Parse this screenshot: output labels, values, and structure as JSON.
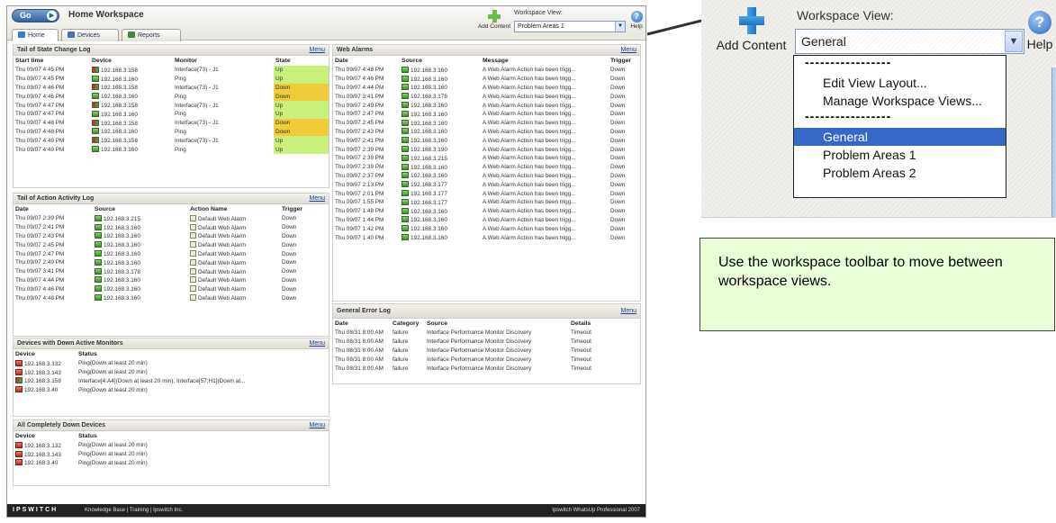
{
  "app": {
    "go_label": "Go",
    "title": "Home Workspace",
    "tabs": [
      {
        "label": "Home",
        "icon": "home-icon",
        "color": "#3b7ad3"
      },
      {
        "label": "Devices",
        "icon": "devices-icon",
        "color": "#4f6fb0"
      },
      {
        "label": "Reports",
        "icon": "reports-icon",
        "color": "#3f8a3a"
      }
    ],
    "add_content_label": "Add Content",
    "workspace_view_label": "Workspace View:",
    "workspace_view_selected": "Problem Areas 1",
    "help_label": "Help"
  },
  "state_change": {
    "title": "Tail of State Change Log",
    "menu": "Menu",
    "columns": [
      "Start time",
      "Device",
      "Monitor",
      "State"
    ],
    "rows": [
      {
        "time": "Thu 09/07 4:45 PM",
        "device": "192.168.3.158",
        "icon": "mix",
        "monitor": "Interface(73) - J1",
        "state": "Up"
      },
      {
        "time": "Thu 09/07 4:45 PM",
        "device": "192.168.3.160",
        "icon": "green",
        "monitor": "Ping",
        "state": "Up"
      },
      {
        "time": "Thu 09/07 4:46 PM",
        "device": "192.168.3.158",
        "icon": "mix",
        "monitor": "Interface(73) - J1",
        "state": "Down"
      },
      {
        "time": "Thu 09/07 4:46 PM",
        "device": "192.168.3.160",
        "icon": "green",
        "monitor": "Ping",
        "state": "Down"
      },
      {
        "time": "Thu 09/07 4:47 PM",
        "device": "192.168.3.158",
        "icon": "mix",
        "monitor": "Interface(73) - J1",
        "state": "Up"
      },
      {
        "time": "Thu 09/07 4:47 PM",
        "device": "192.168.3.160",
        "icon": "green",
        "monitor": "Ping",
        "state": "Up"
      },
      {
        "time": "Thu 09/07 4:48 PM",
        "device": "192.168.3.158",
        "icon": "mix",
        "monitor": "Interface(73) - J1",
        "state": "Down"
      },
      {
        "time": "Thu 09/07 4:48 PM",
        "device": "192.168.3.160",
        "icon": "green",
        "monitor": "Ping",
        "state": "Down"
      },
      {
        "time": "Thu 09/07 4:49 PM",
        "device": "192.168.3.158",
        "icon": "mix",
        "monitor": "Interface(73) - J1",
        "state": "Up"
      },
      {
        "time": "Thu 09/07 4:49 PM",
        "device": "192.168.3.160",
        "icon": "green",
        "monitor": "Ping",
        "state": "Up"
      }
    ]
  },
  "action_activity": {
    "title": "Tail of Action Activity Log",
    "menu": "Menu",
    "columns": [
      "Date",
      "Source",
      "Action Name",
      "Trigger"
    ],
    "rows": [
      {
        "date": "Thu 09/07 2:39 PM",
        "source": "192.168.3.215",
        "action": "Default Web Alarm",
        "trigger": "Down"
      },
      {
        "date": "Thu 09/07 2:41 PM",
        "source": "192.168.3.160",
        "action": "Default Web Alarm",
        "trigger": "Down"
      },
      {
        "date": "Thu 09/07 2:43 PM",
        "source": "192.168.3.160",
        "action": "Default Web Alarm",
        "trigger": "Down"
      },
      {
        "date": "Thu 09/07 2:45 PM",
        "source": "192.168.3.160",
        "action": "Default Web Alarm",
        "trigger": "Down"
      },
      {
        "date": "Thu 09/07 2:47 PM",
        "source": "192.168.3.160",
        "action": "Default Web Alarm",
        "trigger": "Down"
      },
      {
        "date": "Thu 09/07 2:49 PM",
        "source": "192.168.3.160",
        "action": "Default Web Alarm",
        "trigger": "Down"
      },
      {
        "date": "Thu 09/07 3:41 PM",
        "source": "192.168.3.178",
        "action": "Default Web Alarm",
        "trigger": "Down"
      },
      {
        "date": "Thu 09/07 4:44 PM",
        "source": "192.168.3.160",
        "action": "Default Web Alarm",
        "trigger": "Down"
      },
      {
        "date": "Thu 09/07 4:46 PM",
        "source": "192.168.3.160",
        "action": "Default Web Alarm",
        "trigger": "Down"
      },
      {
        "date": "Thu 09/07 4:48 PM",
        "source": "192.168.3.160",
        "action": "Default Web Alarm",
        "trigger": "Down"
      }
    ]
  },
  "down_monitors": {
    "title": "Devices with Down Active Monitors",
    "menu": "Menu",
    "columns": [
      "Device",
      "Status"
    ],
    "rows": [
      {
        "device": "192.168.3.132",
        "icon": "red",
        "status": "Ping(Down at least 20 min)"
      },
      {
        "device": "192.168.3.143",
        "icon": "red",
        "status": "Ping(Down at least 20 min)"
      },
      {
        "device": "192.168.3.158",
        "icon": "mix",
        "status": "Interface[4:A4](Down at least 20 min); Interface[57:H1](Down at..."
      },
      {
        "device": "192.168.3.40",
        "icon": "red",
        "status": "Ping(Down at least 20 min)"
      }
    ]
  },
  "completely_down": {
    "title": "All Completely Down Devices",
    "menu": "Menu",
    "columns": [
      "Device",
      "Status"
    ],
    "rows": [
      {
        "device": "192.168.3.132",
        "status": "Ping(Down at least 20 min)"
      },
      {
        "device": "192.168.3.143",
        "status": "Ping(Down at least 20 min)"
      },
      {
        "device": "192.168.3.40",
        "status": "Ping(Down at least 20 min)"
      }
    ]
  },
  "web_alarms": {
    "title": "Web Alarms",
    "menu": "Menu",
    "columns": [
      "Date",
      "Source",
      "Message",
      "Trigger"
    ],
    "message": "A Web Alarm Action has been trigg...",
    "rows": [
      {
        "date": "Thu 09/07 4:48 PM",
        "source": "192.168.3.160",
        "trigger": "Down"
      },
      {
        "date": "Thu 09/07 4:46 PM",
        "source": "192.168.3.160",
        "trigger": "Down"
      },
      {
        "date": "Thu 09/07 4:44 PM",
        "source": "192.168.3.160",
        "trigger": "Down"
      },
      {
        "date": "Thu 09/07 3:41 PM",
        "source": "192.168.3.178",
        "trigger": "Down"
      },
      {
        "date": "Thu 09/07 2:49 PM",
        "source": "192.168.3.160",
        "trigger": "Down"
      },
      {
        "date": "Thu 09/07 2:47 PM",
        "source": "192.168.3.160",
        "trigger": "Down"
      },
      {
        "date": "Thu 09/07 2:45 PM",
        "source": "192.168.3.160",
        "trigger": "Down"
      },
      {
        "date": "Thu 09/07 2:43 PM",
        "source": "192.168.3.160",
        "trigger": "Down"
      },
      {
        "date": "Thu 09/07 2:41 PM",
        "source": "192.168.3.160",
        "trigger": "Down"
      },
      {
        "date": "Thu 09/07 2:39 PM",
        "source": "192.168.3.190",
        "trigger": "Down"
      },
      {
        "date": "Thu 09/07 2:39 PM",
        "source": "192.168.3.215",
        "trigger": "Down"
      },
      {
        "date": "Thu 09/07 2:39 PM",
        "source": "192.168.3.160",
        "trigger": "Down"
      },
      {
        "date": "Thu 09/07 2:37 PM",
        "source": "192.168.3.160",
        "trigger": "Down"
      },
      {
        "date": "Thu 09/07 2:13 PM",
        "source": "192.168.3.177",
        "trigger": "Down"
      },
      {
        "date": "Thu 09/07 2:01 PM",
        "source": "192.168.3.177",
        "trigger": "Down"
      },
      {
        "date": "Thu 09/07 1:55 PM",
        "source": "192.168.3.177",
        "trigger": "Down"
      },
      {
        "date": "Thu 09/07 1:48 PM",
        "source": "192.168.3.160",
        "trigger": "Down"
      },
      {
        "date": "Thu 09/07 1:44 PM",
        "source": "192.168.3.160",
        "trigger": "Down"
      },
      {
        "date": "Thu 09/07 1:42 PM",
        "source": "192.168.3.160",
        "trigger": "Down"
      },
      {
        "date": "Thu 09/07 1:40 PM",
        "source": "192.168.3.160",
        "trigger": "Down"
      }
    ]
  },
  "general_errors": {
    "title": "General Error Log",
    "menu": "Menu",
    "columns": [
      "Date",
      "Category",
      "Source",
      "Details"
    ],
    "rows": [
      {
        "date": "Thu 08/31 8:00 AM",
        "category": "failure",
        "source": "Interface Performance Monitor Discovery",
        "details": "Timeout"
      },
      {
        "date": "Thu 08/31 8:00 AM",
        "category": "failure",
        "source": "Interface Performance Monitor Discovery",
        "details": "Timeout"
      },
      {
        "date": "Thu 08/31 8:00 AM",
        "category": "failure",
        "source": "Interface Performance Monitor Discovery",
        "details": "Timeout"
      },
      {
        "date": "Thu 08/31 8:00 AM",
        "category": "failure",
        "source": "Interface Performance Monitor Discovery",
        "details": "Timeout"
      },
      {
        "date": "Thu 08/31 8:00 AM",
        "category": "failure",
        "source": "Interface Performance Monitor Discovery",
        "details": "Timeout"
      }
    ]
  },
  "footer": {
    "logo": "IPSWITCH",
    "links": "Knowledge Base  |  Training  |  Ipswitch Inc.",
    "product": "Ipswitch WhatsUp Professional 2007"
  },
  "zoom": {
    "add_content_label": "Add Content",
    "workspace_view_label": "Workspace View:",
    "selected": "General",
    "help_label": "Help",
    "separator": "-----------------",
    "items": [
      "Edit View Layout...",
      "Manage Workspace Views...",
      "General",
      "Problem Areas 1",
      "Problem Areas 2"
    ]
  },
  "callout": {
    "text": "Use the workspace toolbar to move between workspace views."
  },
  "colors": {
    "state_up": "#c8f07a",
    "state_down": "#f0cc3a",
    "selected_item": "#3568c8",
    "callout_bg": "#eaffd8"
  }
}
